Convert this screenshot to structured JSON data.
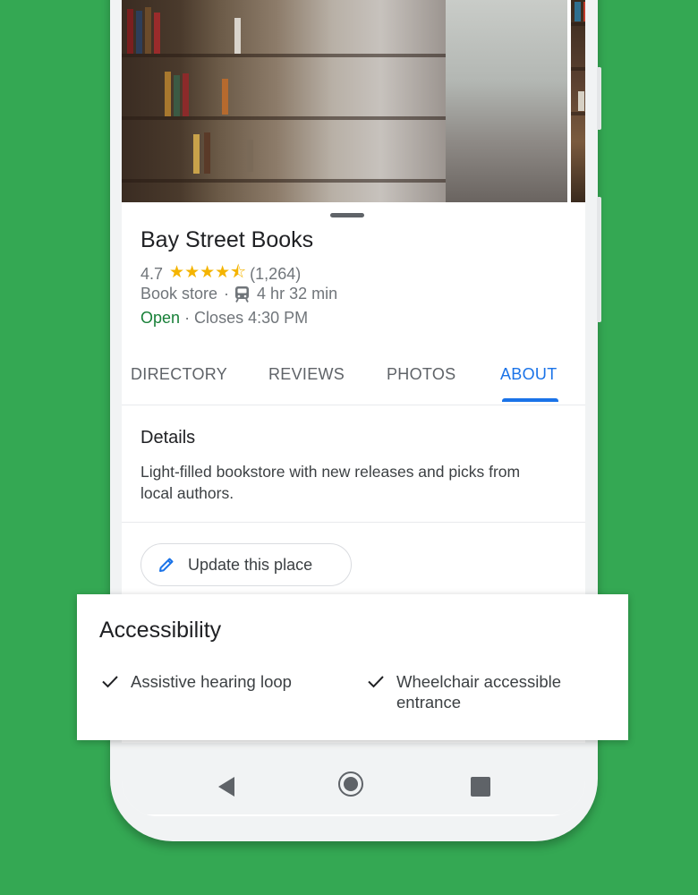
{
  "place": {
    "name": "Bay Street Books",
    "rating": "4.7",
    "stars": "★★★★⯪",
    "review_count": "(1,264)",
    "category": "Book store",
    "separator": "·",
    "transit_time": "4 hr 32 min",
    "status": "Open",
    "hours": "· Closes 4:30 PM"
  },
  "tabs": [
    {
      "label": "DIRECTORY"
    },
    {
      "label": "REVIEWS"
    },
    {
      "label": "PHOTOS"
    },
    {
      "label": "ABOUT",
      "active": true
    }
  ],
  "details": {
    "title": "Details",
    "description": "Light-filled bookstore with new releases and picks from local authors."
  },
  "update_button": {
    "label": "Update this place",
    "icon": "pencil-icon"
  },
  "accessibility": {
    "title": "Accessibility",
    "items": [
      {
        "label": "Assistive hearing loop",
        "icon": "check-icon"
      },
      {
        "label": "Wheelchair accessible entrance",
        "icon": "check-icon"
      }
    ]
  },
  "navbar": {
    "icons": [
      "back-icon",
      "home-icon",
      "recents-icon"
    ]
  },
  "colors": {
    "background": "#34a853",
    "accent": "#1a73e8",
    "open_green": "#188038",
    "star": "#f4b400"
  }
}
